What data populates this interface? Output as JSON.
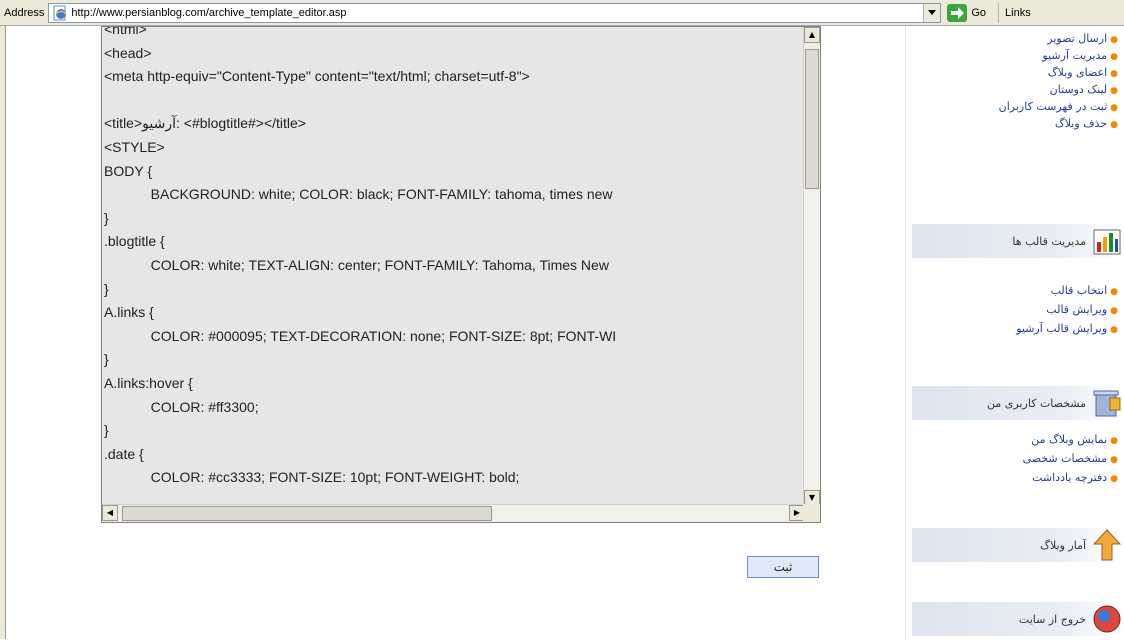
{
  "address_bar": {
    "label": "Address",
    "url": "http://www.persianblog.com/archive_template_editor.asp",
    "go_label": "Go",
    "links_label": "Links"
  },
  "editor": {
    "lines": [
      "<html>",
      "<head>",
      "<meta http-equiv=\"Content-Type\" content=\"text/html; charset=utf-8\">",
      "",
      "<title>آرشیو: <#blogtitle#></title>",
      "<STYLE>",
      "BODY {",
      "\t    BACKGROUND: white; COLOR: black; FONT-FAMILY: tahoma, times new",
      "}",
      ".blogtitle {",
      "\t    COLOR: white; TEXT-ALIGN: center; FONT-FAMILY: Tahoma, Times New",
      "}",
      "A.links {",
      "\t    COLOR: #000095; TEXT-DECORATION: none; FONT-SIZE: 8pt; FONT-WI",
      "}",
      "A.links:hover {",
      "\t    COLOR: #ff3300;",
      "}",
      ".date {",
      "\t    COLOR: #cc3333; FONT-SIZE: 10pt; FONT-WEIGHT: bold;"
    ]
  },
  "submit_label": "ثبت",
  "sidebar": {
    "top_links": [
      "ارسال تصویر",
      "مدیریت آرشیو",
      "اعضای وبلاگ",
      "لینک دوستان",
      "ثبت در فهرست کاربران",
      "حذف وبلاگ"
    ],
    "template_section": {
      "title": "مدیریت قالب ها",
      "icon": "chart-icon",
      "links": [
        "انتخاب قالب",
        "ویرایش قالب",
        "ویرایش قالب آرشیو"
      ]
    },
    "profile_section": {
      "title": "مشخصات کاربری من",
      "icon": "trash-profile-icon",
      "links": [
        "نمایش وبلاگ من",
        "مشخصات شخصی",
        "دفترچه یادداشت"
      ]
    },
    "stats_section": {
      "title": "آمار وبلاگ",
      "icon": "arrow-up-icon"
    },
    "exit_section": {
      "title": "خروج از سایت",
      "icon": "exit-icon"
    }
  }
}
